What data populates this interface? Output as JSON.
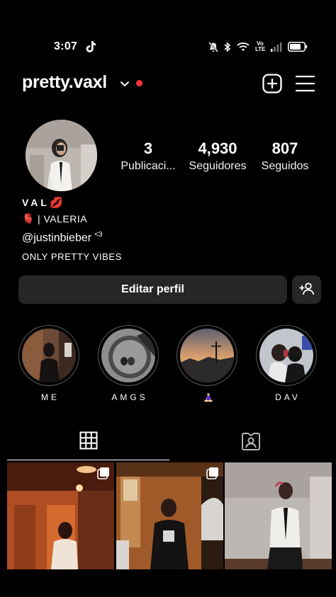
{
  "status_bar": {
    "time": "3:07",
    "network_label": "Vo LTE",
    "icons": [
      "tiktok-icon",
      "mute-icon",
      "bluetooth-icon",
      "wifi-icon",
      "volte-icon",
      "signal-icon",
      "battery-icon"
    ]
  },
  "header": {
    "username": "pretty.vaxl",
    "notification_dot_color": "#ff3040",
    "icons": [
      "chevron-down-icon",
      "add-post-icon",
      "menu-icon"
    ]
  },
  "stats": {
    "posts": {
      "value": "3",
      "label": "Publicaci..."
    },
    "followers": {
      "value": "4,930",
      "label": "Seguidores"
    },
    "following": {
      "value": "807",
      "label": "Seguidos"
    }
  },
  "bio": {
    "name": "VAL",
    "name_emoji": "💋",
    "line1_emoji": "🫀",
    "line1_text": "| VALERIA",
    "link": "@justinbieber",
    "link_suffix": "<3",
    "line3": "ONLY PRETTY VIBES"
  },
  "buttons": {
    "edit_profile": "Editar perfil",
    "discover_people_icon": "add-person-icon"
  },
  "highlights": [
    {
      "label": "ME"
    },
    {
      "label": "AMGS"
    },
    {
      "label": "🧘🏻‍♀️"
    },
    {
      "label": "DAV"
    }
  ],
  "tabs": [
    {
      "name": "grid",
      "icon": "grid-icon",
      "active": true
    },
    {
      "name": "tagged",
      "icon": "tagged-person-icon",
      "active": false
    }
  ],
  "posts": [
    {
      "multiple": true
    },
    {
      "multiple": true
    },
    {
      "multiple": false
    }
  ]
}
